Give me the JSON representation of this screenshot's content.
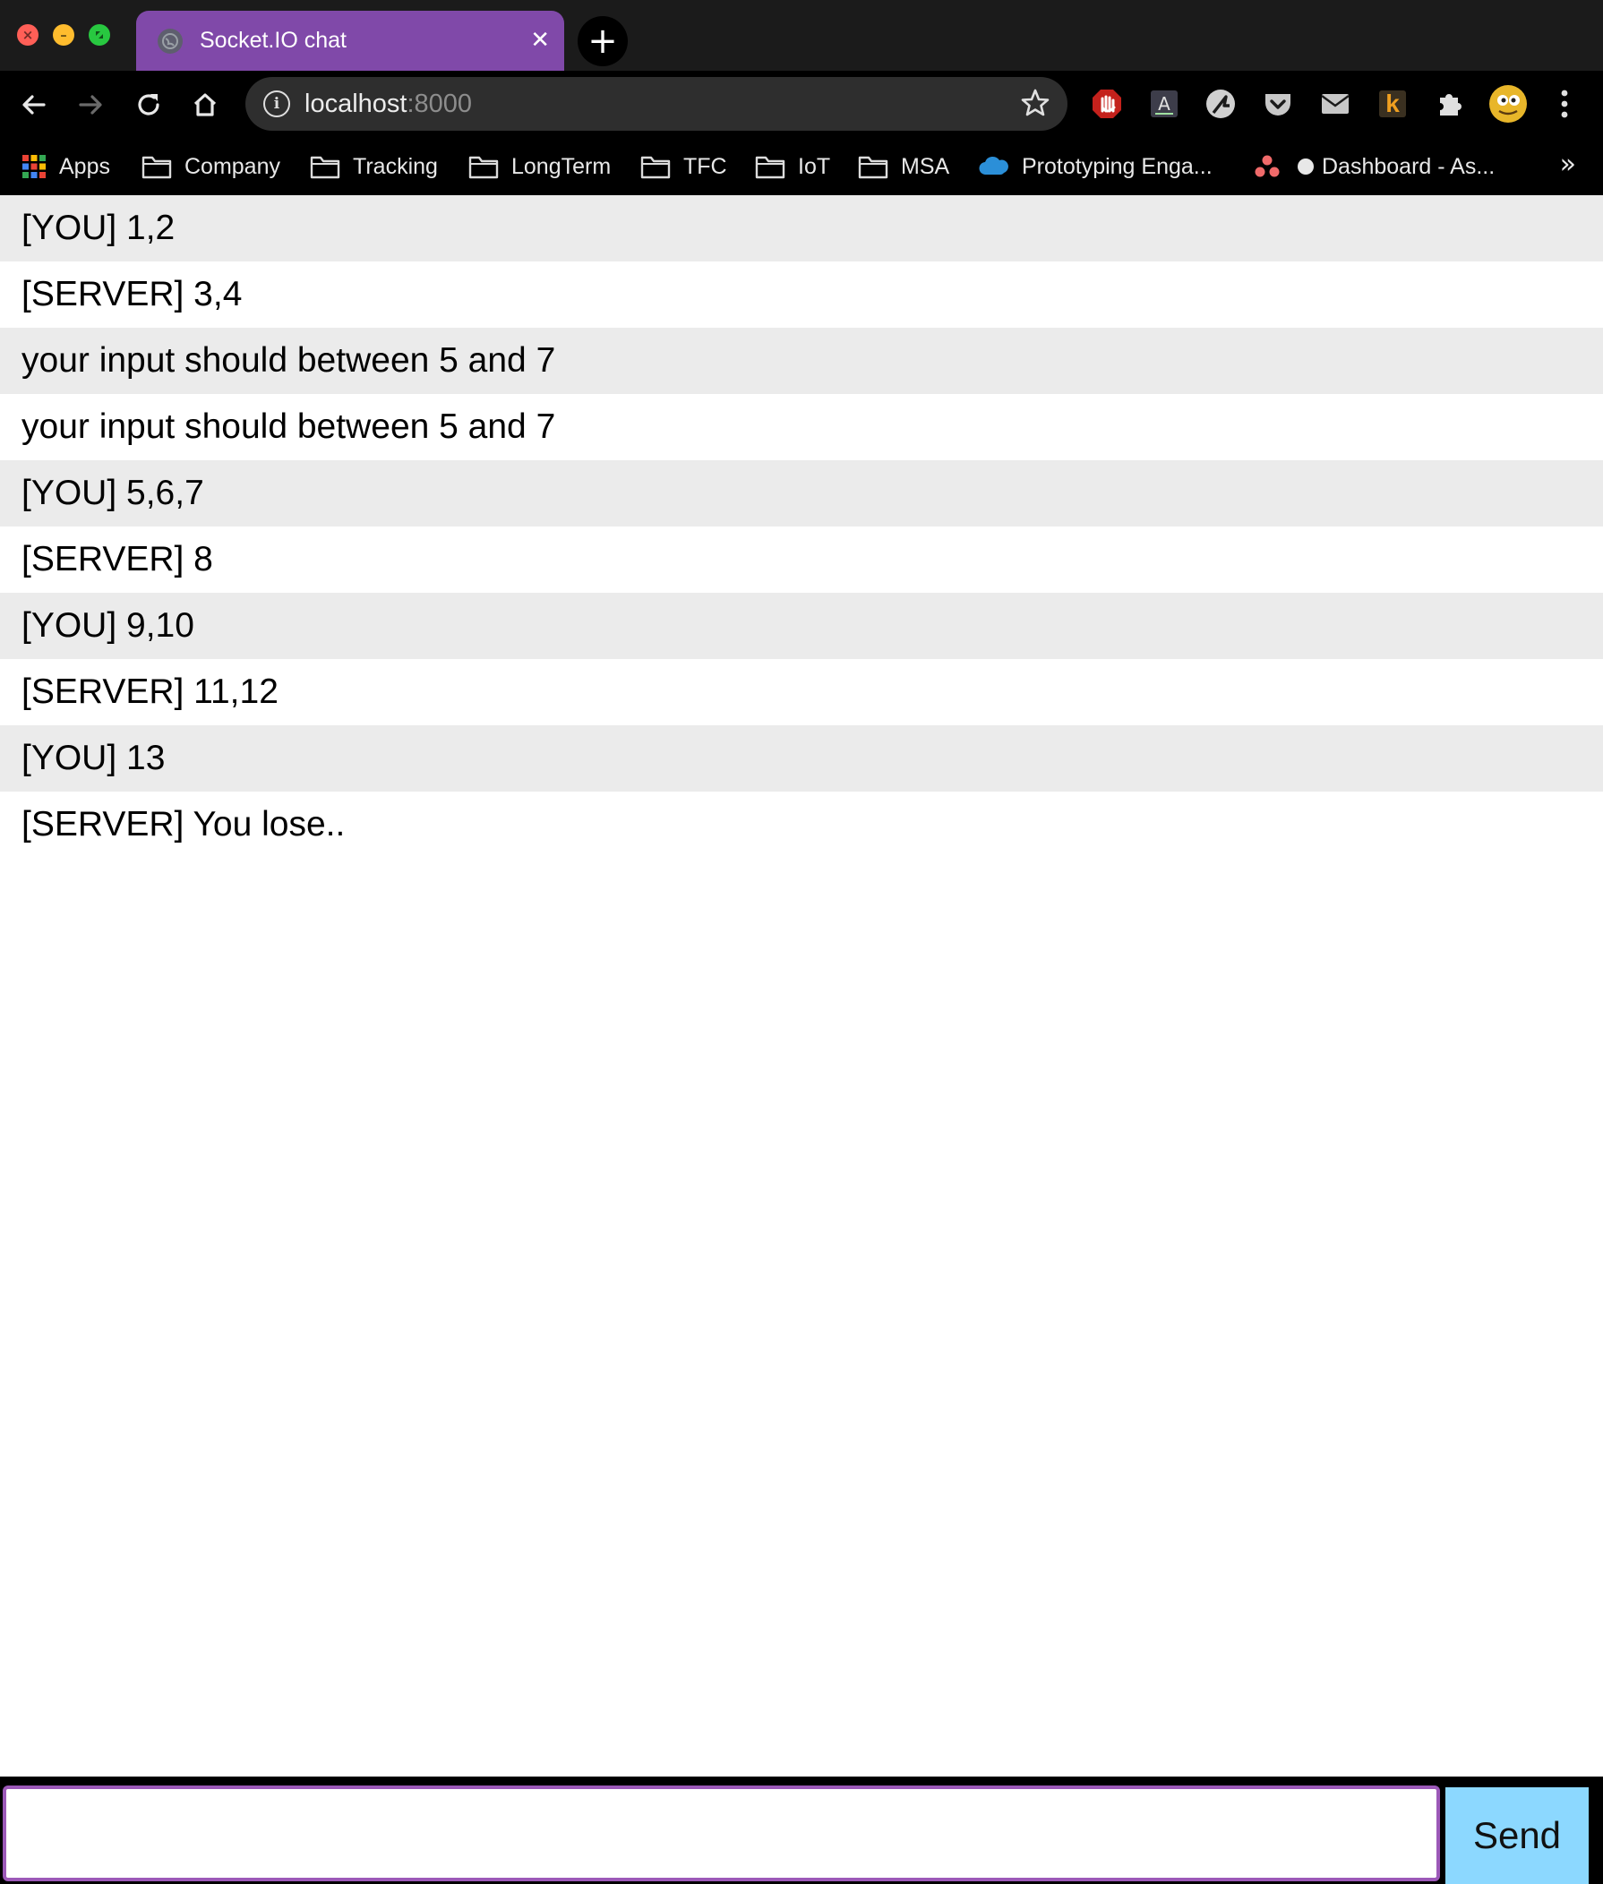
{
  "browser": {
    "tab": {
      "title": "Socket.IO chat",
      "close_glyph": "✕"
    },
    "new_tab_glyph": "+",
    "address": {
      "host": "localhost",
      "port": ":8000"
    },
    "extensions": [
      "ublock-icon",
      "accessibility-checker-icon",
      "rapid-icon",
      "pocket-icon",
      "mail-icon",
      "k-extension-icon",
      "puzzle-icon",
      "profile-avatar"
    ],
    "k_extension_label": "k",
    "bookmarks": [
      {
        "label": "Apps",
        "icon": "apps-grid-icon"
      },
      {
        "label": "Company",
        "icon": "folder-icon"
      },
      {
        "label": "Tracking",
        "icon": "folder-icon"
      },
      {
        "label": "LongTerm",
        "icon": "folder-icon"
      },
      {
        "label": "TFC",
        "icon": "folder-icon"
      },
      {
        "label": "IoT",
        "icon": "folder-icon"
      },
      {
        "label": "MSA",
        "icon": "folder-icon"
      },
      {
        "label": "Prototyping Enga...",
        "icon": "cloud-icon"
      },
      {
        "label": "",
        "icon": "asana-icon"
      },
      {
        "label": "Dashboard - As...",
        "icon": "circle-icon"
      }
    ],
    "bookmarks_overflow": "»"
  },
  "chat": {
    "messages": [
      "[YOU] 1,2",
      "[SERVER] 3,4",
      "your input should between 5 and 7",
      "your input should between 5 and 7",
      "[YOU] 5,6,7",
      "[SERVER] 8",
      "[YOU] 9,10",
      "[SERVER] 11,12",
      "[YOU] 13",
      "[SERVER] You lose.."
    ],
    "input_value": "",
    "send_label": "Send"
  },
  "colors": {
    "tab_active": "#8049a9",
    "chrome_bg": "#000000",
    "row_alt": "#ebebeb",
    "input_border": "#9c59b8",
    "send_button": "#8cd8ff"
  }
}
